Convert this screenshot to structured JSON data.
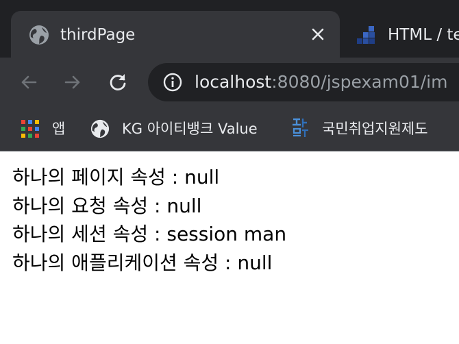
{
  "tabs": [
    {
      "title": "thirdPage",
      "active": true,
      "icon": "globe-icon"
    },
    {
      "title": "HTML / te",
      "active": false,
      "icon": "site-favicon"
    }
  ],
  "toolbar": {
    "url_host": "localhost",
    "url_rest": ":8080/jspexam01/im"
  },
  "bookmarks": [
    {
      "label": "앱",
      "icon": "apps-grid-icon"
    },
    {
      "label": "KG 아이티뱅크 Value",
      "icon": "globe-icon"
    },
    {
      "label": "국민취업지원제도",
      "icon": "site-favicon"
    }
  ],
  "content": {
    "lines": [
      "하나의 페이지 속성 : null",
      "하나의 요청 속성 : null",
      "하나의 세션 속성 : session man",
      "하나의 애플리케이션 속성 : null"
    ]
  },
  "colors": {
    "tabstrip": "#202124",
    "toolbar": "#35363a",
    "text_light": "#e8eaed",
    "text_dim": "#9aa0a6"
  }
}
